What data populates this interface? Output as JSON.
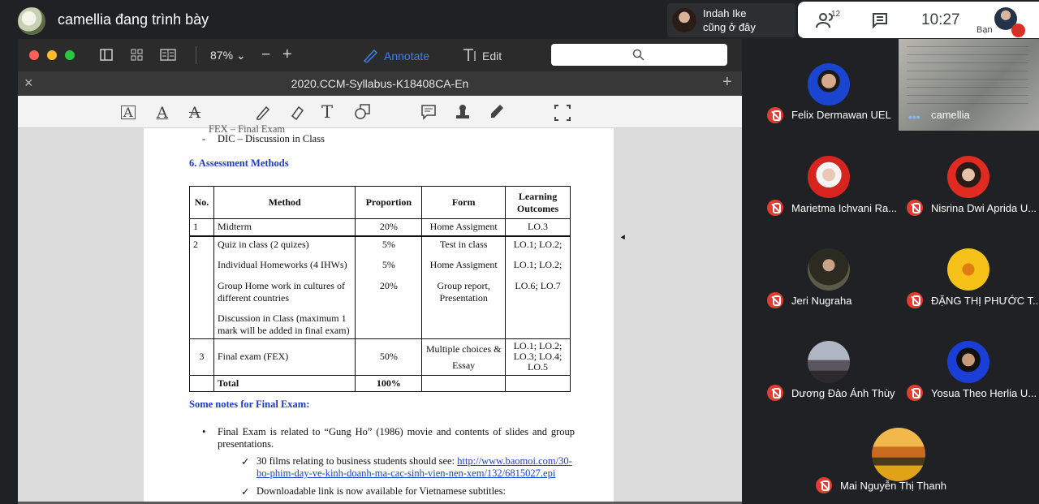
{
  "meet": {
    "presenter_label": "camellia đang trình bày",
    "notice": {
      "line1": "Indah Ike",
      "line2": "cũng ở đây"
    },
    "people_count": "12",
    "clock": "10:27",
    "me_label": "Bạn"
  },
  "preview": {
    "zoom": "87% ⌄",
    "zoom_out": "−",
    "zoom_in": "+",
    "annotate": "Annotate",
    "edit": "Edit",
    "tab_close": "×",
    "doc_title": "2020.CCM-Syllabus-K18408CA-En",
    "new_tab": "+"
  },
  "doc": {
    "partial_line": "FEX – Final Exam",
    "dic_line": "DIC – Discussion in Class",
    "section_heading": "6. Assessment Methods",
    "table": {
      "headers": [
        "No.",
        "Method",
        "Proportion",
        "Form",
        "Learning Outcomes"
      ],
      "rows": [
        {
          "no": "1",
          "method": "Midterm",
          "proportion": "20%",
          "form": "Home Assigment",
          "lo": "LO.3"
        },
        {
          "no": "2",
          "method": "Quiz in class (2 quizes)",
          "proportion": "5%",
          "form": "Test in class",
          "lo": "LO.1; LO.2;"
        },
        {
          "no": "",
          "method": "Individual Homeworks (4 IHWs)",
          "proportion": "5%",
          "form": "Home Assigment",
          "lo": "LO.1; LO.2;"
        },
        {
          "no": "",
          "method": "Group Home work in cultures of different countries",
          "proportion": "20%",
          "form": "Group report, Presentation",
          "lo": "LO.6; LO.7"
        },
        {
          "no": "",
          "method": "Discussion in Class (maximum 1 mark will be added in final exam)",
          "proportion": "",
          "form": "",
          "lo": ""
        },
        {
          "no": "3",
          "method": "Final exam (FEX)",
          "proportion": "50%",
          "form": "Multiple choices & Essay",
          "lo": "LO.1; LO.2; LO.3; LO.4; LO.5"
        },
        {
          "no": "",
          "method": "Total",
          "proportion": "100%",
          "form": "",
          "lo": ""
        }
      ]
    },
    "notes_heading": "Some notes for Final Exam:",
    "bullet1": "Final Exam is related to “Gung Ho” (1986) movie and contents of slides and group presentations.",
    "check1_text": "30 films relating to business students should see:",
    "check1_link": "http://www.baomoi.com/30-bo-phim-day-ve-kinh-doanh-ma-cac-sinh-vien-nen-xem/132/6815027.epi",
    "check2_text": "Downloadable link is now available for Vietnamese subtitles:"
  },
  "participants": [
    {
      "name": "Felix Dermawan UEL",
      "muted": true
    },
    {
      "name": "camellia",
      "muted": false
    },
    {
      "name": "Marietma Ichvani Ra...",
      "muted": true
    },
    {
      "name": "Nisrina Dwi Aprida U...",
      "muted": true
    },
    {
      "name": "Jeri Nugraha",
      "muted": true
    },
    {
      "name": "ĐẶNG THỊ PHƯỚC T...",
      "muted": true
    },
    {
      "name": "Dương Đào Ánh Thùy",
      "muted": true
    },
    {
      "name": "Yosua Theo Herlia U...",
      "muted": true
    },
    {
      "name": "Mai Nguyễn Thị Thanh",
      "muted": true
    }
  ]
}
